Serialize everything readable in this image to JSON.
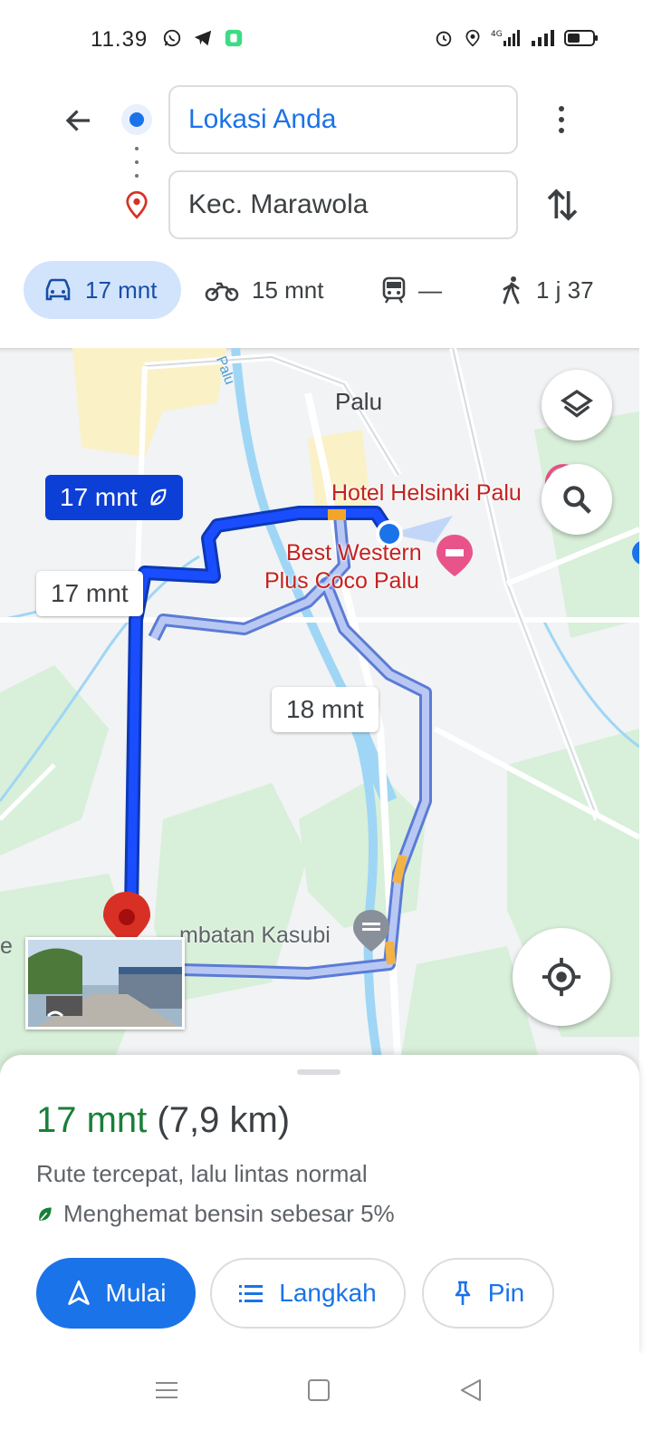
{
  "status_bar": {
    "time": "11.39",
    "left_icons": [
      "whatsapp-icon",
      "telegram-icon",
      "app-icon"
    ],
    "right_icons": [
      "alarm-icon",
      "location-icon",
      "signal-4g-icon",
      "signal-icon",
      "battery-icon"
    ],
    "network_label": "4G"
  },
  "search": {
    "origin": "Lokasi Anda",
    "destination": "Kec. Marawola"
  },
  "modes": {
    "car": "17 mnt",
    "motorcycle": "15 mnt",
    "transit": "—",
    "walk": "1 j 37"
  },
  "map": {
    "city_label": "Palu",
    "river_label": "Palu",
    "poi_hotel_helsinki": "Hotel Helsinki Palu",
    "poi_best_western_line1": "Best Western",
    "poi_best_western_line2": "Plus Coco Palu",
    "poi_bridge": "mbatan Kasubi",
    "edge_label": "e",
    "route_primary_time": "17 mnt",
    "route_alt1_time": "17 mnt",
    "route_alt2_time": "18 mnt"
  },
  "sheet": {
    "duration": "17 mnt",
    "distance": "(7,9 km)",
    "description": "Rute tercepat, lalu lintas normal",
    "eco_note": "Menghemat bensin sebesar 5%",
    "start_label": "Mulai",
    "steps_label": "Langkah",
    "pin_label": "Pin"
  },
  "colors": {
    "accent": "#1a73e8",
    "route_primary": "#0b3fd6",
    "route_alt": "#8ea6ee",
    "eta_green": "#188038",
    "poi_red": "#c5221f"
  }
}
